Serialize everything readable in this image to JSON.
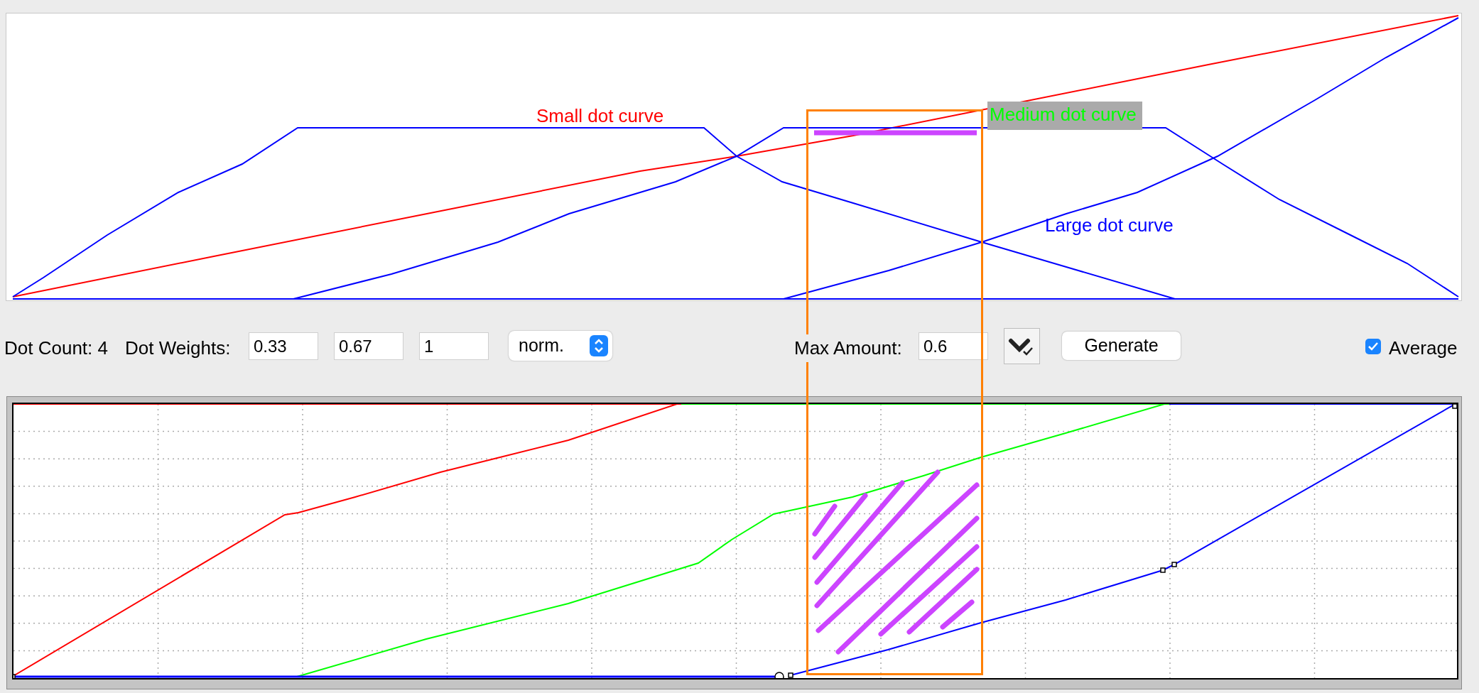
{
  "top_chart": {
    "labels": [
      {
        "text": "Small dot curve",
        "color": "#ff0000",
        "highlighted": false
      },
      {
        "text": "Medium dot curve",
        "color": "#00ff00",
        "highlighted": true
      },
      {
        "text": "Large dot curve",
        "color": "#0000ff",
        "highlighted": false
      }
    ]
  },
  "controls": {
    "dot_count": "Dot Count: 4",
    "weights_label": "Dot Weights:",
    "weights": [
      "0.33",
      "0.67",
      "1"
    ],
    "mode": "norm.",
    "max_amount_label": "Max Amount:",
    "max_amount": "0.6",
    "generate_button": "Generate",
    "average": {
      "label": "Average",
      "checked": true
    }
  }
}
